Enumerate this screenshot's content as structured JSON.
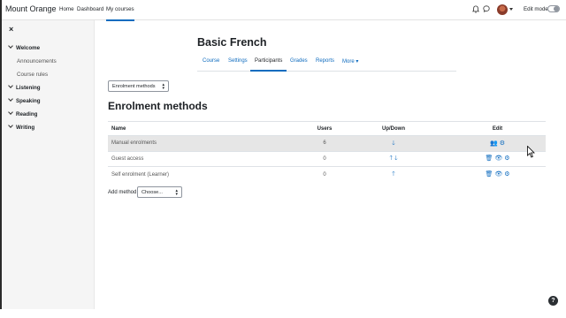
{
  "navbar": {
    "brand": "Mount Orange",
    "links": [
      "Home",
      "Dashboard",
      "My courses"
    ],
    "edit_mode_label": "Edit mode",
    "edit_mode_on": false
  },
  "drawer": {
    "close": "×",
    "sections": [
      {
        "label": "Welcome",
        "items": [
          "Announcements",
          "Course rules"
        ]
      },
      {
        "label": "Listening",
        "items": []
      },
      {
        "label": "Speaking",
        "items": []
      },
      {
        "label": "Reading",
        "items": []
      },
      {
        "label": "Writing",
        "items": []
      }
    ]
  },
  "course": {
    "title": "Basic French",
    "tabs": [
      "Course",
      "Settings",
      "Participants",
      "Grades",
      "Reports",
      "More ▾"
    ],
    "active_tab": "Participants"
  },
  "page": {
    "jump_select": "Enrolment methods",
    "heading": "Enrolment methods",
    "table": {
      "headers": [
        "Name",
        "Users",
        "Up/Down",
        "Edit"
      ],
      "rows": [
        {
          "name": "Manual enrolments",
          "users": "6",
          "updown": "↓",
          "edit": [
            "enrol-users-icon",
            "gear-icon"
          ]
        },
        {
          "name": "Guest access",
          "users": "0",
          "updown": "↑↓",
          "edit": [
            "trash-icon",
            "eye-icon",
            "gear-icon"
          ]
        },
        {
          "name": "Self enrolment (Learner)",
          "users": "0",
          "updown": "↑",
          "edit": [
            "trash-icon",
            "eye-icon",
            "gear-icon"
          ]
        }
      ]
    },
    "add_method_label": "Add method",
    "add_method_select": "Choose..."
  },
  "help": "?",
  "colors": {
    "accent": "#0f6cbf",
    "drawer_bg": "#f5f5f5",
    "row_highlight": "#e6e6e6"
  }
}
